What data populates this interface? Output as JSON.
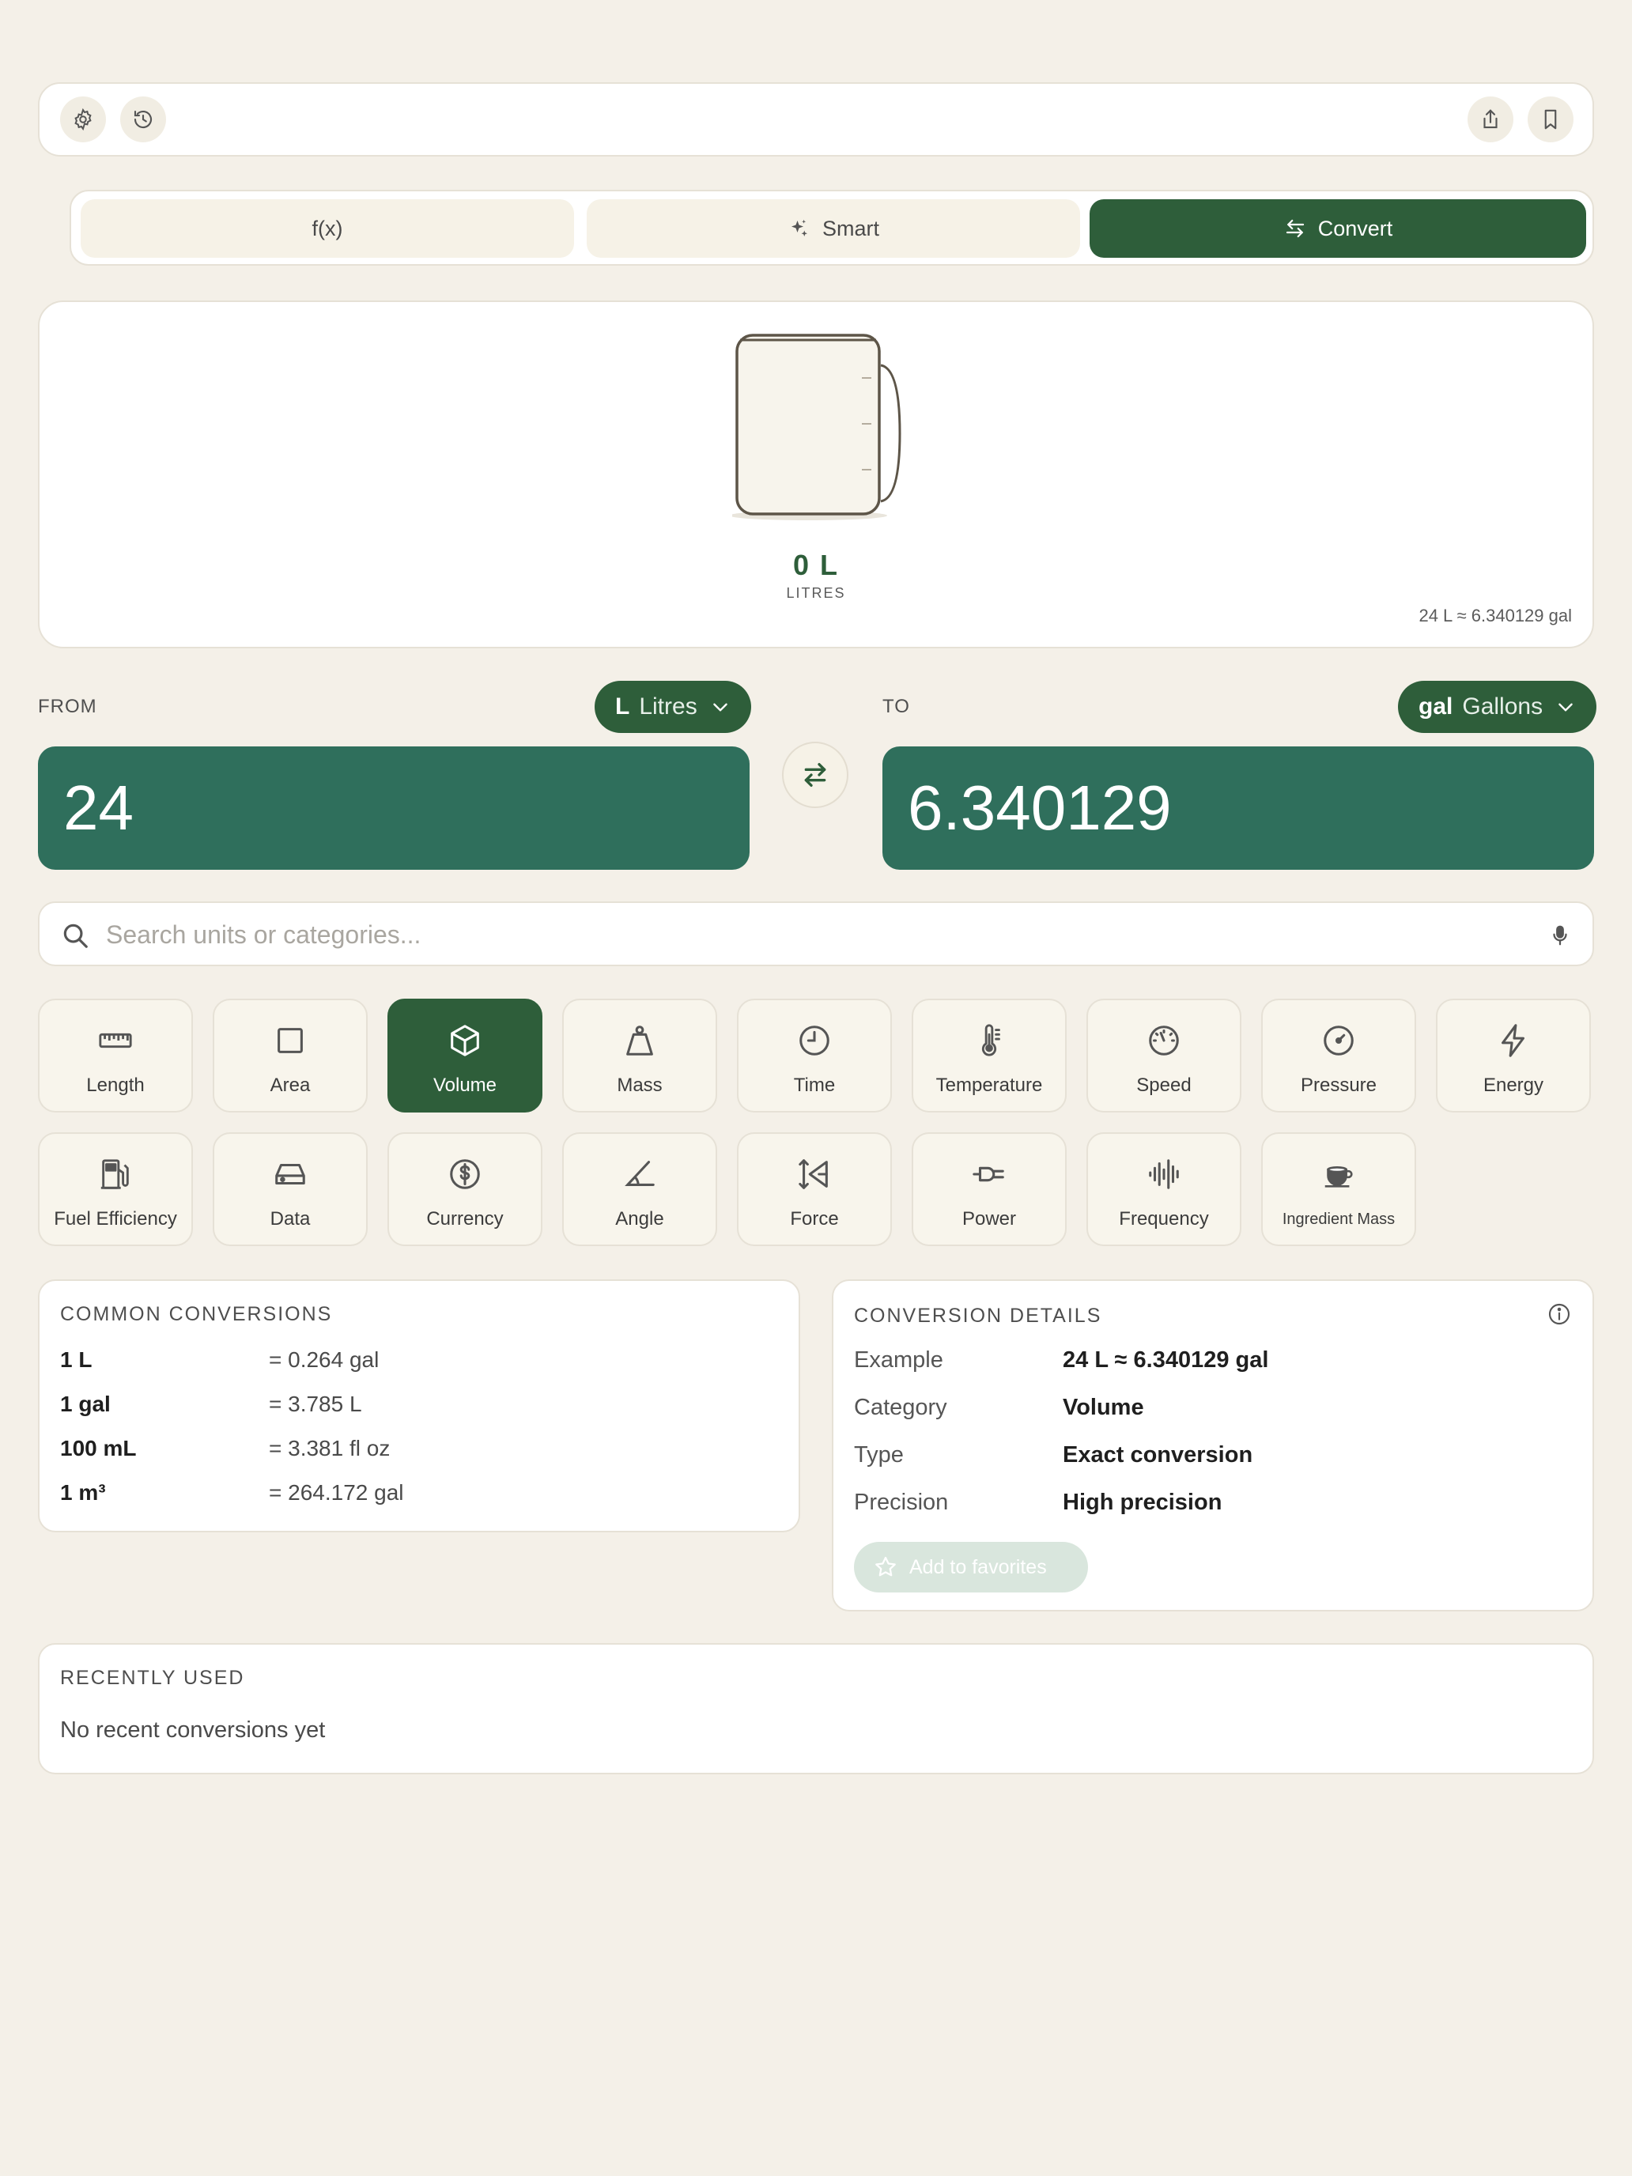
{
  "toolbar": {
    "left_icons": [
      "gear-icon",
      "history-icon"
    ],
    "right_icons": [
      "share-icon",
      "bookmark-icon"
    ]
  },
  "modes": [
    {
      "label": "f(x)",
      "icon": "",
      "active": false
    },
    {
      "label": "Smart",
      "icon": "sparkle-icon",
      "active": false
    },
    {
      "label": "Convert",
      "icon": "convert-arrows-icon",
      "active": true
    }
  ],
  "visual": {
    "value": "0 L",
    "unit_name": "LITRES",
    "note": "24 L ≈ 6.340129 gal",
    "fill_fraction": 0
  },
  "converter": {
    "from_label": "FROM",
    "to_label": "TO",
    "from_unit": {
      "symbol": "L",
      "name": "Litres"
    },
    "to_unit": {
      "symbol": "gal",
      "name": "Gallons"
    },
    "from_value": "24",
    "to_value": "6.340129"
  },
  "search": {
    "placeholder": "Search units or categories..."
  },
  "categories": [
    {
      "label": "Length",
      "icon": "ruler-icon",
      "active": false
    },
    {
      "label": "Area",
      "icon": "square-icon",
      "active": false
    },
    {
      "label": "Volume",
      "icon": "cube-icon",
      "active": true
    },
    {
      "label": "Mass",
      "icon": "weight-icon",
      "active": false
    },
    {
      "label": "Time",
      "icon": "clock-icon",
      "active": false
    },
    {
      "label": "Temperature",
      "icon": "thermometer-icon",
      "active": false
    },
    {
      "label": "Speed",
      "icon": "speedometer-icon",
      "active": false
    },
    {
      "label": "Pressure",
      "icon": "gauge-icon",
      "active": false
    },
    {
      "label": "Energy",
      "icon": "bolt-icon",
      "active": false
    },
    {
      "label": "Fuel Efficiency",
      "icon": "fuel-pump-icon",
      "active": false
    },
    {
      "label": "Data",
      "icon": "hard-drive-icon",
      "active": false
    },
    {
      "label": "Currency",
      "icon": "dollar-circle-icon",
      "active": false
    },
    {
      "label": "Angle",
      "icon": "angle-icon",
      "active": false
    },
    {
      "label": "Force",
      "icon": "force-icon",
      "active": false
    },
    {
      "label": "Power",
      "icon": "plug-icon",
      "active": false
    },
    {
      "label": "Frequency",
      "icon": "waveform-icon",
      "active": false
    },
    {
      "label": "Ingredient Mass",
      "icon": "cup-icon",
      "active": false
    }
  ],
  "common": {
    "title": "COMMON CONVERSIONS",
    "rows": [
      {
        "left": "1 L",
        "right": "= 0.264 gal"
      },
      {
        "left": "1 gal",
        "right": "= 3.785 L"
      },
      {
        "left": "100 mL",
        "right": "= 3.381 fl oz"
      },
      {
        "left": "1 m³",
        "right": "= 264.172 gal"
      }
    ]
  },
  "details": {
    "title": "CONVERSION DETAILS",
    "rows": [
      {
        "key": "Example",
        "value": "24 L ≈ 6.340129 gal"
      },
      {
        "key": "Category",
        "value": "Volume"
      },
      {
        "key": "Type",
        "value": "Exact conversion"
      },
      {
        "key": "Precision",
        "value": "High precision"
      }
    ],
    "favorite_label": "Add to favorites"
  },
  "recent": {
    "title": "RECENTLY USED",
    "empty_text": "No recent conversions yet"
  },
  "colors": {
    "accent": "#2e5e3a",
    "value_box": "#2f6f5c",
    "background": "#f4f0e8"
  }
}
